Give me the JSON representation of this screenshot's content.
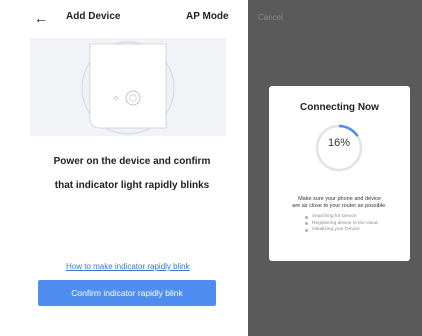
{
  "left_screen": {
    "header": {
      "back_icon": "arrow-left-icon",
      "title": "Add Device",
      "mode": "AP Mode"
    },
    "illustration": "device-indicator-illustration",
    "instructions": {
      "line1": "Power on the device and confirm",
      "line2": "that indicator light rapidly blinks"
    },
    "help_link": "How to make indicator rapidly blink",
    "confirm_button": "Confirm indicator rapidly blink",
    "colors": {
      "accent": "#4f8ef0",
      "link": "#3b74d4"
    }
  },
  "right_screen": {
    "cancel_label": "Cancel",
    "dialog": {
      "title": "Connecting Now",
      "progress_text": "16%",
      "progress_value": 0.16,
      "message_line1": "Make sure your phone and device",
      "message_line2": "are as close to your router as possible.",
      "steps": [
        "Searching for Device",
        "Registering device to the cloud",
        "Initializing your Device"
      ]
    },
    "colors": {
      "overlay": "#5a5a5a",
      "progress": "#4f8ef0",
      "track": "#e3e3e3"
    }
  }
}
